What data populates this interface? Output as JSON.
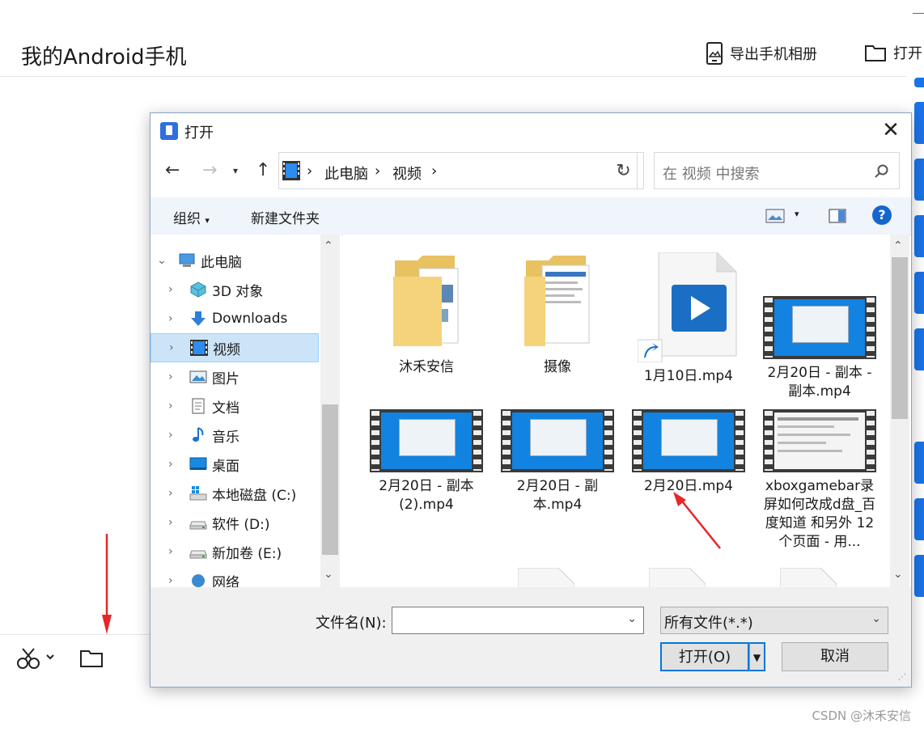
{
  "app": {
    "title": "我的Android手机",
    "export_label": "导出手机相册",
    "open_label": "打开",
    "watermark": "CSDN @沐禾安信"
  },
  "dialog": {
    "title": "打开",
    "address": {
      "crumbs": [
        "此电脑",
        "视频"
      ]
    },
    "search": {
      "placeholder": "在 视频 中搜索"
    },
    "toolbar": {
      "organize": "组织",
      "new_folder": "新建文件夹"
    },
    "tree": [
      {
        "label": "此电脑",
        "icon": "computer-icon",
        "expanded": true,
        "selected": false
      },
      {
        "label": "3D 对象",
        "icon": "3d-objects-icon",
        "expanded": false,
        "selected": false
      },
      {
        "label": "Downloads",
        "icon": "download-icon",
        "expanded": false,
        "selected": false
      },
      {
        "label": "视频",
        "icon": "video-folder-icon",
        "expanded": false,
        "selected": true
      },
      {
        "label": "图片",
        "icon": "pictures-icon",
        "expanded": false,
        "selected": false
      },
      {
        "label": "文档",
        "icon": "documents-icon",
        "expanded": false,
        "selected": false
      },
      {
        "label": "音乐",
        "icon": "music-icon",
        "expanded": false,
        "selected": false
      },
      {
        "label": "桌面",
        "icon": "desktop-icon",
        "expanded": false,
        "selected": false
      },
      {
        "label": "本地磁盘 (C:)",
        "icon": "windows-drive-icon",
        "expanded": false,
        "selected": false
      },
      {
        "label": "软件 (D:)",
        "icon": "drive-icon",
        "expanded": false,
        "selected": false
      },
      {
        "label": "新加卷 (E:)",
        "icon": "drive-icon",
        "expanded": false,
        "selected": false
      },
      {
        "label": "网络",
        "icon": "network-icon",
        "expanded": false,
        "selected": false
      }
    ],
    "files": [
      {
        "name": "沐禾安信",
        "kind": "folder"
      },
      {
        "name": "摄像",
        "kind": "folder-docs"
      },
      {
        "name": "1月10日.mp4",
        "kind": "shortcut-video"
      },
      {
        "name": "2月20日 - 副本 - 副本.mp4",
        "kind": "video"
      },
      {
        "name": "2月20日 - 副本 (2).mp4",
        "kind": "video"
      },
      {
        "name": "2月20日 - 副本.mp4",
        "kind": "video"
      },
      {
        "name": "2月20日.mp4",
        "kind": "video"
      },
      {
        "name": "xboxgamebar录屏如何改成d盘_百度知道 和另外 12 个页面 - 用...",
        "kind": "video-web"
      }
    ],
    "filename": {
      "label": "文件名(N):",
      "value": ""
    },
    "filetype": {
      "value": "所有文件(*.*)"
    },
    "buttons": {
      "open": "打开(O)",
      "cancel": "取消"
    }
  },
  "colors": {
    "accent": "#0078d7",
    "selection": "#cce4f7",
    "annotation_arrow": "#e8262a",
    "side_tab": "#1a73e8"
  }
}
